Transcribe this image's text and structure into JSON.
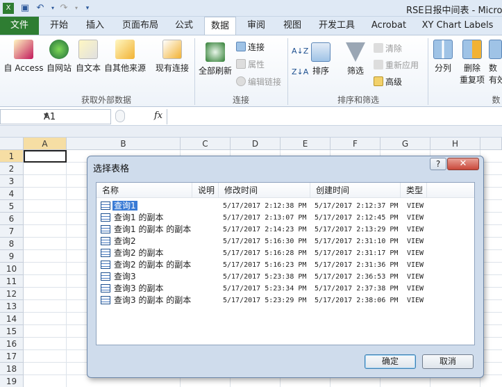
{
  "window": {
    "title": "RSE日报中间表 - Micro"
  },
  "tabs": [
    {
      "label": "文件"
    },
    {
      "label": "开始"
    },
    {
      "label": "插入"
    },
    {
      "label": "页面布局"
    },
    {
      "label": "公式"
    },
    {
      "label": "数据"
    },
    {
      "label": "审阅"
    },
    {
      "label": "视图"
    },
    {
      "label": "开发工具"
    },
    {
      "label": "Acrobat"
    },
    {
      "label": "XY Chart Labels"
    }
  ],
  "ribbon": {
    "get_external": {
      "label": "获取外部数据",
      "buttons": [
        "自 Access",
        "自网站",
        "自文本",
        "自其他来源",
        "现有连接"
      ]
    },
    "connections": {
      "label": "连接",
      "refresh_all": "全部刷新",
      "connections": "连接",
      "properties": "属性",
      "edit_links": "编辑链接"
    },
    "sort_filter": {
      "label": "排序和筛选",
      "sort": "排序",
      "filter": "筛选",
      "clear": "清除",
      "reapply": "重新应用",
      "advanced": "高级",
      "az": "A↓Z",
      "za": "Z↓A"
    },
    "data_tools": {
      "label": "数",
      "split": "分列",
      "remove_dup_1": "删除",
      "remove_dup_2": "重复项",
      "validate_1": "数",
      "validate_2": "有效"
    }
  },
  "formula_bar": {
    "cell_ref": "A1",
    "fx": "fx"
  },
  "grid": {
    "columns": [
      "A",
      "B",
      "C",
      "D",
      "E",
      "F",
      "G",
      "H"
    ],
    "rows": [
      "1",
      "2",
      "3",
      "4",
      "5",
      "6",
      "7",
      "8",
      "9",
      "10",
      "11",
      "12",
      "13",
      "14",
      "15",
      "16",
      "17",
      "18",
      "19"
    ]
  },
  "dialog": {
    "title": "选择表格",
    "help": "?",
    "close": "✕",
    "columns": [
      "名称",
      "说明",
      "修改时间",
      "创建时间",
      "类型"
    ],
    "rows": [
      {
        "name": "查询1",
        "modified": "5/17/2017 2:12:38 PM",
        "created": "5/17/2017 2:12:37 PM",
        "type": "VIEW"
      },
      {
        "name": "查询1 的副本",
        "modified": "5/17/2017 2:13:07 PM",
        "created": "5/17/2017 2:12:45 PM",
        "type": "VIEW"
      },
      {
        "name": "查询1 的副本 的副本",
        "modified": "5/17/2017 2:14:23 PM",
        "created": "5/17/2017 2:13:29 PM",
        "type": "VIEW"
      },
      {
        "name": "查询2",
        "modified": "5/17/2017 5:16:30 PM",
        "created": "5/17/2017 2:31:10 PM",
        "type": "VIEW"
      },
      {
        "name": "查询2 的副本",
        "modified": "5/17/2017 5:16:28 PM",
        "created": "5/17/2017 2:31:17 PM",
        "type": "VIEW"
      },
      {
        "name": "查询2 的副本 的副本",
        "modified": "5/17/2017 5:16:23 PM",
        "created": "5/17/2017 2:31:36 PM",
        "type": "VIEW"
      },
      {
        "name": "查询3",
        "modified": "5/17/2017 5:23:38 PM",
        "created": "5/17/2017 2:36:53 PM",
        "type": "VIEW"
      },
      {
        "name": "查询3 的副本",
        "modified": "5/17/2017 5:23:34 PM",
        "created": "5/17/2017 2:37:38 PM",
        "type": "VIEW"
      },
      {
        "name": "查询3 的副本 的副本",
        "modified": "5/17/2017 5:23:29 PM",
        "created": "5/17/2017 2:38:06 PM",
        "type": "VIEW"
      }
    ],
    "ok": "确定",
    "cancel": "取消"
  }
}
